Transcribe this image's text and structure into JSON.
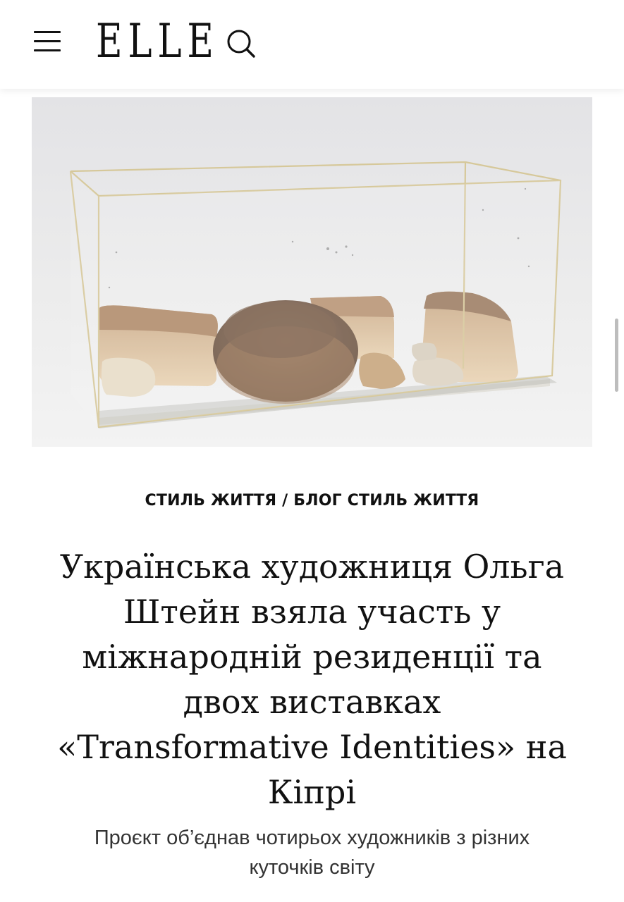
{
  "header": {
    "logo": "ELLE",
    "menu_icon": "hamburger-menu-icon",
    "search_icon": "search-icon"
  },
  "hero": {
    "image_icon": "bread-in-glass-case-artwork"
  },
  "article": {
    "category_primary": "СТИЛЬ ЖИТТЯ",
    "category_separator": "/",
    "category_secondary": "БЛОГ СТИЛЬ ЖИТТЯ",
    "title": "Українська художниця Ольга Штейн взяла участь у міжнародній резиденції та двох виставках «Transformative Identities» на Кіпрі",
    "subtitle": "Проєкт об’єднав чотирьох художників з різних куточків світу"
  },
  "colors": {
    "text": "#111111",
    "background": "#ffffff",
    "subtitle": "#333333"
  }
}
